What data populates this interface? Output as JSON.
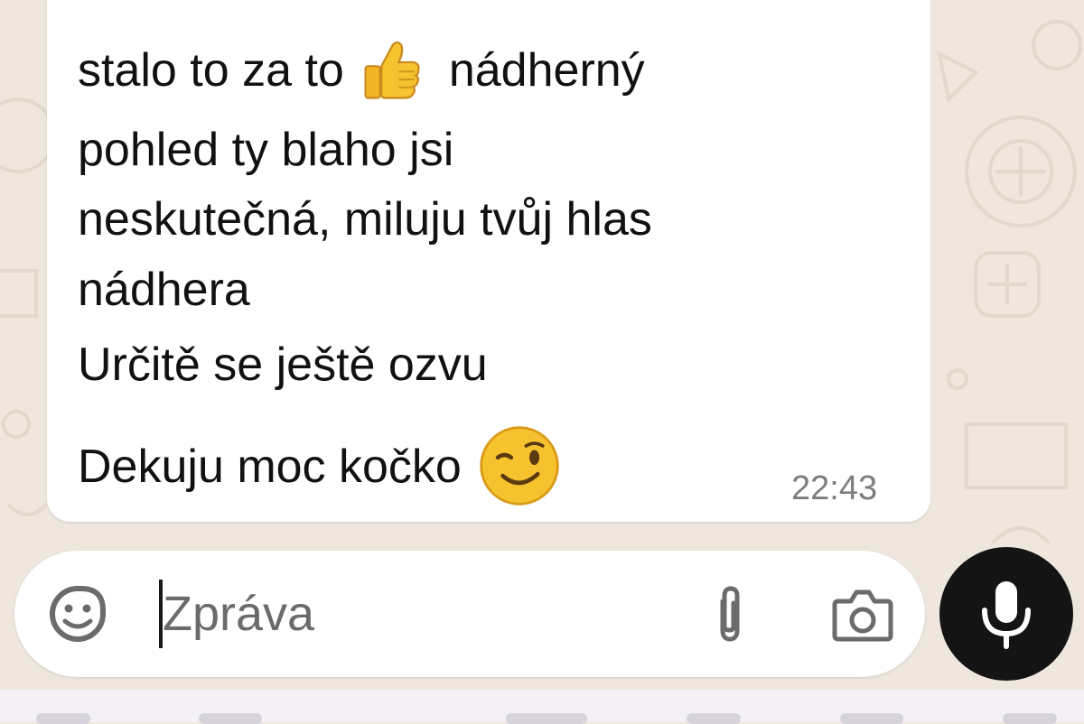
{
  "message": {
    "lines": [
      "stalo to za to",
      "nádherný",
      "pohled ty blaho jsi",
      "neskutečná, miluju tvůj hlas",
      "nádhera",
      "Určitě se ještě ozvu",
      "Dekuju moc kočko"
    ],
    "time": "22:43",
    "emojis": [
      "thumbs-up",
      "winking-face"
    ]
  },
  "composer": {
    "placeholder": "Zpráva",
    "value": "",
    "icons": [
      "sticker-icon",
      "attach-icon",
      "camera-icon"
    ]
  },
  "mic": {
    "icon": "microphone-icon"
  },
  "colors": {
    "wallpaper": "#efe7dd",
    "bubble": "#ffffff",
    "mic_button": "#141414",
    "timestamp": "#7d7d7d",
    "emoji_yellow": "#f6c22d"
  }
}
